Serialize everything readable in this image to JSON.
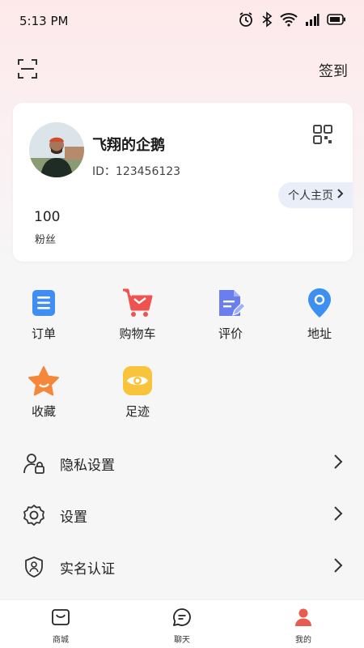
{
  "status_bar": {
    "time": "5:13 PM",
    "icons": [
      "alarm-icon",
      "bluetooth-icon",
      "wifi-icon",
      "signal-icon",
      "battery-icon"
    ]
  },
  "topbar": {
    "scan_icon": "scan-icon",
    "checkin_label": "签到"
  },
  "profile": {
    "name": "飞翔的企鹅",
    "id_text": "ID：123456123",
    "qr_icon": "qr-code-icon",
    "homepage_label": "个人主页",
    "fans_count": "100",
    "fans_label": "粉丝"
  },
  "shortcuts": [
    {
      "label": "订单",
      "icon": "order-icon",
      "color": "#3f8ef3"
    },
    {
      "label": "购物车",
      "icon": "cart-icon",
      "color": "#ef5350"
    },
    {
      "label": "评价",
      "icon": "review-icon",
      "color": "#6a7ef0"
    },
    {
      "label": "地址",
      "icon": "location-icon",
      "color": "#3d8ff0"
    },
    {
      "label": "收藏",
      "icon": "star-icon",
      "color": "#f5873a"
    },
    {
      "label": "足迹",
      "icon": "eye-icon",
      "color": "#f7c43c"
    }
  ],
  "menu": [
    {
      "label": "隐私设置",
      "icon": "privacy-icon"
    },
    {
      "label": "设置",
      "icon": "gear-icon"
    },
    {
      "label": "实名认证",
      "icon": "shield-icon"
    }
  ],
  "tabs": [
    {
      "label": "商城",
      "icon": "shop-icon",
      "active": false
    },
    {
      "label": "聊天",
      "icon": "chat-icon",
      "active": false
    },
    {
      "label": "我的",
      "icon": "user-icon",
      "active": true
    }
  ],
  "colors": {
    "accent": "#e85c50",
    "tag_bg": "#e9eef8"
  }
}
